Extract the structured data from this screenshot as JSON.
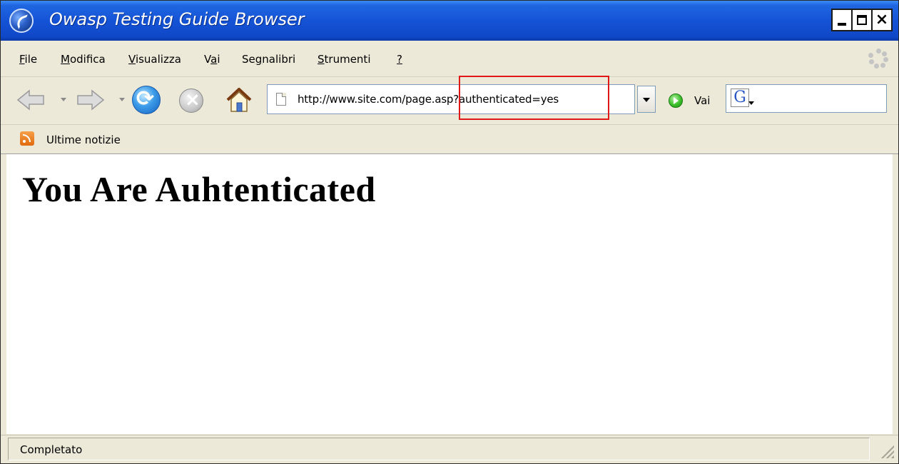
{
  "window": {
    "title": "Owasp Testing Guide Browser"
  },
  "menu": {
    "items": [
      {
        "label": "File",
        "accel": "F"
      },
      {
        "label": "Modifica",
        "accel": "M"
      },
      {
        "label": "Visualizza",
        "accel": "V"
      },
      {
        "label": "Vai",
        "accel": "a"
      },
      {
        "label": "Segnalibri",
        "accel": "g"
      },
      {
        "label": "Strumenti",
        "accel": "S"
      },
      {
        "label": "?",
        "accel": "?"
      }
    ]
  },
  "toolbar": {
    "url": "http://www.site.com/page.asp?authenticated=yes",
    "go_label": "Vai",
    "search_value": "",
    "icons": {
      "back": "back-arrow-icon",
      "forward": "forward-arrow-icon",
      "reload": "reload-icon",
      "stop": "stop-icon",
      "home": "home-icon",
      "go": "go-icon",
      "search_engine": "google-icon"
    }
  },
  "bookmarks": {
    "items": [
      {
        "label": "Ultime notizie",
        "icon": "rss-icon"
      }
    ]
  },
  "page": {
    "heading": "You Are Auhtenticated"
  },
  "status": {
    "text": "Completato"
  },
  "colors": {
    "titlebar": "#1553d6",
    "chrome": "#ECE9D8",
    "highlight": "#e01818"
  }
}
